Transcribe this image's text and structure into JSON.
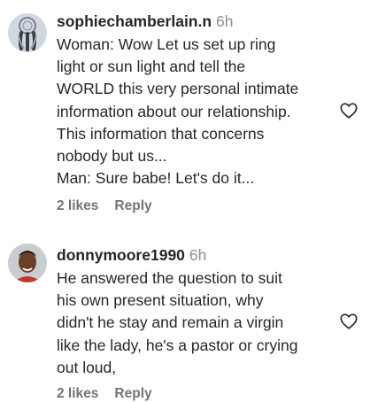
{
  "comments": [
    {
      "username": "sophiechamberlain.n",
      "time": "6h",
      "text": "Woman: Wow Let us set up ring\nlight or sun light and tell the\nWORLD this very personal intimate\ninformation about our relationship.\nThis information that concerns\nnobody but us...\nMan: Sure babe! Let's do it...",
      "likes": "2 likes",
      "reply": "Reply",
      "avatar_icon": "feather-dreamcatcher-avatar"
    },
    {
      "username": "donnymoore1990",
      "time": "6h",
      "text": "He answered the question to suit\nhis own present situation, why\ndidn't he stay and remain a virgin\nlike the lady, he's a pastor or crying\nout loud,",
      "likes": "2 likes",
      "reply": "Reply",
      "avatar_icon": "man-portrait-avatar"
    }
  ]
}
